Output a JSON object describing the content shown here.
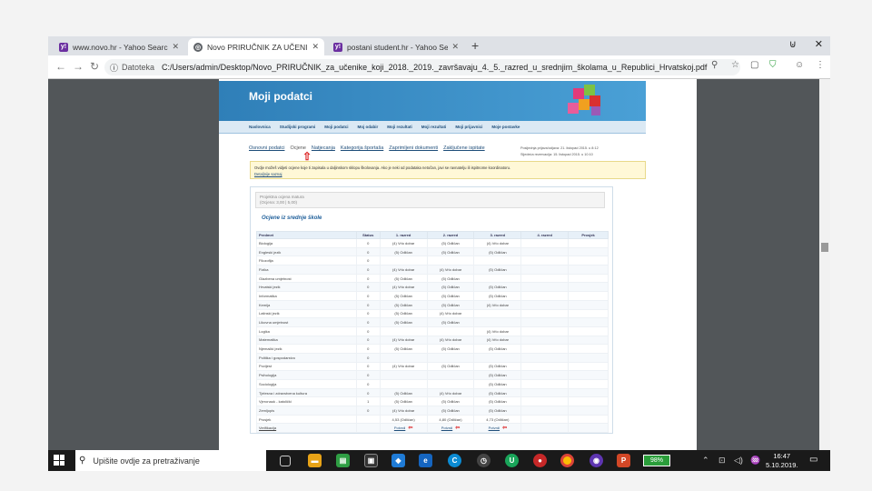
{
  "browser": {
    "tabs": [
      {
        "title": "www.novo.hr - Yahoo Search Re",
        "icon": "yahoo-icon",
        "color": "#6b2fa0"
      },
      {
        "title": "Novo PRIRUČNIK ZA UČENIKE K",
        "icon": "globe-icon",
        "color": "#5f6368"
      },
      {
        "title": "postani student.hr - Yahoo Searc",
        "icon": "yahoo-icon",
        "color": "#6b2fa0"
      }
    ],
    "address": {
      "label": "Datoteka",
      "url": "C:/Users/admin/Desktop/Novo_PRIRUČNIK_za_učenike_koji_2018._2019._završavaju_4._5._razred_u_srednjim_školama_u_Republici_Hrvatskoj.pdf"
    }
  },
  "page": {
    "banner_title": "Moji podatci",
    "menu": [
      "Naslovnica",
      "Studijski programi",
      "Moji podatci",
      "Moj odabir",
      "Moji rezultati",
      "Moji rezultati",
      "Moji prijavnici",
      "Moje postavke"
    ],
    "submenu": [
      "Osnovni podatci",
      "Ocjene",
      "Natjecanja",
      "Kategorija športaša",
      "Zaprimljeni dokumenti",
      "Zaključene ispitate"
    ],
    "submenu_current": 1,
    "right_info": [
      "Posljednja prijava/odjava: 21. listopad 2015. u 8:12",
      "Sljedeća rezervacija: 15. listopad 2015. u 10:10"
    ],
    "info_text": "Ovdje možeš vidjeti ocjene koje ti zapisala u daljinskom sklopu školovanja. Ako je neki od podataka netočan, javi se ravnatelju ili ispitnome koordinatoru.",
    "info_more": "Detaljnije saznaj",
    "notice": [
      "Projektna ocjena matura",
      "(Ocjena: 3,00 | 5,00)"
    ],
    "grades_title": "Ocjene iz srednje škole",
    "grades": {
      "headers": [
        "Predmet",
        "Status",
        "1. razred",
        "2. razred",
        "3. razred",
        "4. razred",
        "Prosjek"
      ],
      "rows": [
        [
          "Biologija",
          "0",
          "(4) Vrlo dobar",
          "(5) Odličan",
          "(4) Vrlo dobar",
          "",
          ""
        ],
        [
          "Engleski jezik",
          "0",
          "(5) Odličan",
          "(5) Odličan",
          "(5) Odličan",
          "",
          ""
        ],
        [
          "Filozofija",
          "0",
          "",
          "",
          "",
          "",
          ""
        ],
        [
          "Fizika",
          "0",
          "(4) Vrlo dobar",
          "(4) Vrlo dobar",
          "(5) Odličan",
          "",
          ""
        ],
        [
          "Glazbena umjetnost",
          "0",
          "(5) Odličan",
          "(5) Odličan",
          "",
          "",
          ""
        ],
        [
          "Hrvatski jezik",
          "0",
          "(4) Vrlo dobar",
          "(5) Odličan",
          "(5) Odličan",
          "",
          ""
        ],
        [
          "Informatika",
          "0",
          "(5) Odličan",
          "(5) Odličan",
          "(5) Odličan",
          "",
          ""
        ],
        [
          "Kemija",
          "0",
          "(5) Odličan",
          "(5) Odličan",
          "(4) Vrlo dobar",
          "",
          ""
        ],
        [
          "Latinski jezik",
          "0",
          "(5) Odličan",
          "(4) Vrlo dobar",
          "",
          "",
          ""
        ],
        [
          "Likovna umjetnost",
          "0",
          "(5) Odličan",
          "(5) Odličan",
          "",
          "",
          ""
        ],
        [
          "Logika",
          "0",
          "",
          "",
          "(4) Vrlo dobar",
          "",
          ""
        ],
        [
          "Matematika",
          "0",
          "(4) Vrlo dobar",
          "(4) Vrlo dobar",
          "(4) Vrlo dobar",
          "",
          ""
        ],
        [
          "Njemački jezik",
          "0",
          "(5) Odličan",
          "(5) Odličan",
          "(5) Odličan",
          "",
          ""
        ],
        [
          "Politika i gospodarstvo",
          "0",
          "",
          "",
          "",
          "",
          ""
        ],
        [
          "Povijest",
          "0",
          "(4) Vrlo dobar",
          "(5) Odličan",
          "(5) Odličan",
          "",
          ""
        ],
        [
          "Psihologija",
          "0",
          "",
          "",
          "(5) Odličan",
          "",
          ""
        ],
        [
          "Sociologija",
          "0",
          "",
          "",
          "(5) Odličan",
          "",
          ""
        ],
        [
          "Tjelesna i zdravstvena kultura",
          "0",
          "(5) Odličan",
          "(4) Vrlo dobar",
          "(5) Odličan",
          "",
          ""
        ],
        [
          "Vjeronauk - katolički",
          "1",
          "(5) Odličan",
          "(5) Odličan",
          "(5) Odličan",
          "",
          ""
        ],
        [
          "Zemljopis",
          "0",
          "(4) Vrlo dobar",
          "(5) Odličan",
          "(5) Odličan",
          "",
          ""
        ],
        [
          "Prosjek",
          "",
          "4,53 (Odličan)",
          "4,80 (Odličan)",
          "4,73 (Odličan)",
          "",
          ""
        ]
      ],
      "verify_label": "Verifikacija",
      "verify_links": [
        "Potvrdi",
        "Potvrdi",
        "Potvrdi"
      ]
    }
  },
  "taskbar": {
    "search_placeholder": "Upišite ovdje za pretraživanje",
    "battery": "98%",
    "time": "16:47",
    "date": "5.10.2019."
  }
}
